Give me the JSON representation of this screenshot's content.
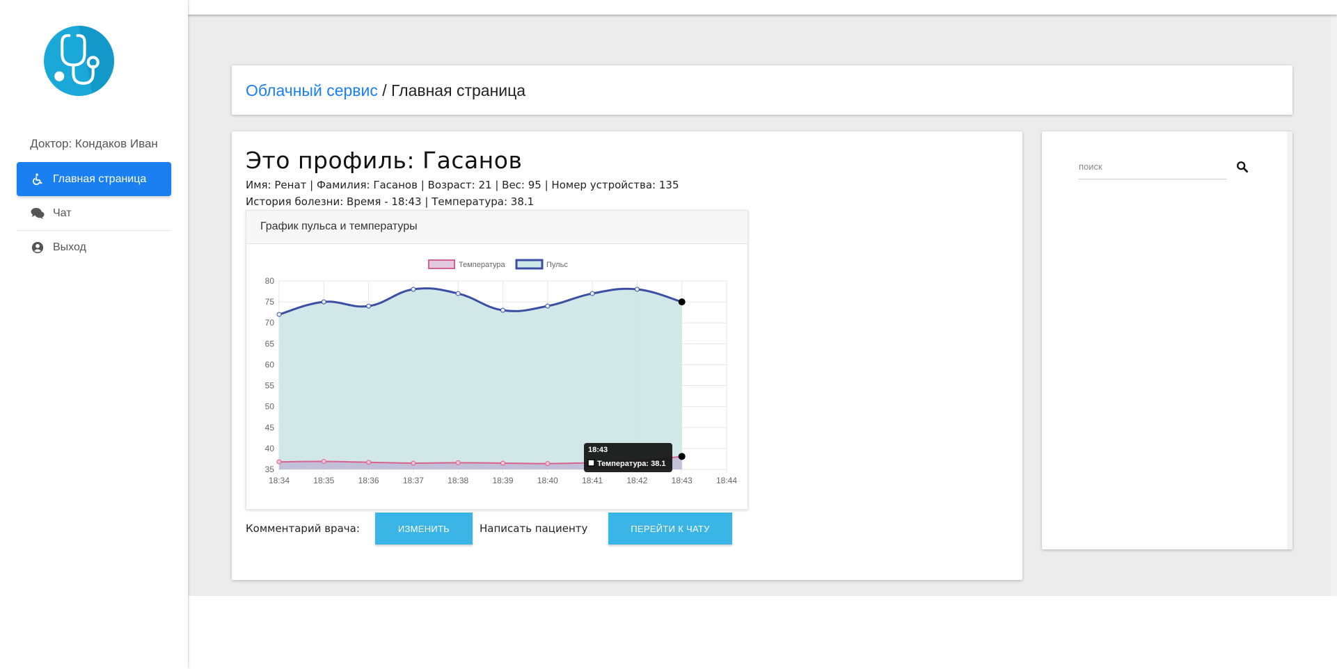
{
  "sidebar": {
    "doctor": "Доктор: Кондаков Иван",
    "items": [
      {
        "label": "Главная страница",
        "icon": "wheelchair-icon",
        "active": true
      },
      {
        "label": "Чат",
        "icon": "comments-icon",
        "active": false
      },
      {
        "label": "Выход",
        "icon": "user-circle-icon",
        "active": false
      }
    ]
  },
  "breadcrumb": {
    "link": "Облачный сервис",
    "separator": " / ",
    "current": "Главная страница"
  },
  "profile": {
    "title": "Это профиль: Гасанов",
    "info": "Имя: Ренат | Фамилия: Гасанов | Возраст: 21 | Вес: 95 | Номер устройства: 135",
    "history": "История болезни: Время - 18:43 | Температура: 38.1"
  },
  "chart_card": {
    "title": "График пульса и температуры"
  },
  "chart_data": {
    "type": "area",
    "categories": [
      "18:34",
      "18:35",
      "18:36",
      "18:37",
      "18:38",
      "18:39",
      "18:40",
      "18:41",
      "18:42",
      "18:43",
      "18:44"
    ],
    "series": [
      {
        "name": "Температура",
        "values": [
          36.8,
          36.9,
          36.7,
          36.5,
          36.6,
          36.5,
          36.4,
          36.6,
          37.0,
          38.1
        ],
        "color": "#d8628f"
      },
      {
        "name": "Пульс",
        "values": [
          72,
          75,
          74,
          78,
          77,
          73,
          74,
          77,
          78,
          75
        ],
        "color": "#3a4fa3"
      }
    ],
    "ylim": [
      35,
      80
    ],
    "yticks": [
      35,
      40,
      45,
      50,
      55,
      60,
      65,
      70,
      75,
      80
    ],
    "legend": "top",
    "grid": true,
    "tooltip": {
      "title": "18:43",
      "text": "Температура: 38.1"
    }
  },
  "actions": {
    "comment_label": "Комментарий врача:",
    "edit_button": "ИЗМЕНИТЬ",
    "write_label": "Написать пациенту",
    "chat_button": "ПЕРЕЙТИ К ЧАТУ"
  },
  "search": {
    "placeholder": "поиск"
  },
  "colors": {
    "accent": "#1a7ff0",
    "button": "#3bb4e6",
    "pulse_fill": "#cde6e6",
    "temp_fill": "#bfb7d6"
  }
}
